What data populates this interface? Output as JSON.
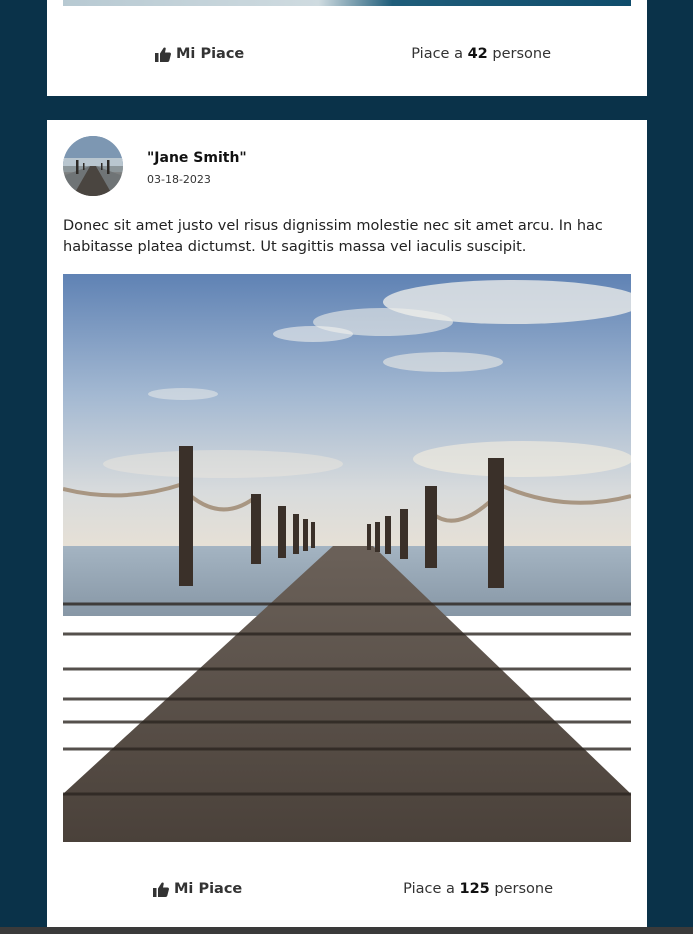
{
  "posts": [
    {
      "like_label": "Mi Piace",
      "likes_prefix": "Piace a ",
      "likes_count": "42",
      "likes_suffix": " persone",
      "like_icon": "thumbs-up-icon"
    },
    {
      "author": "\"Jane Smith\"",
      "date": "03-18-2023",
      "text": "Donec sit amet justo vel risus dignissim molestie nec sit amet arcu. In hac habitasse platea dictumst. Ut sagittis massa vel iaculis suscipit.",
      "like_label": "Mi Piace",
      "likes_prefix": "Piace a ",
      "likes_count": "125",
      "likes_suffix": " persone",
      "like_icon": "thumbs-up-icon"
    }
  ],
  "colors": {
    "page_background": "#0a3249",
    "card_background": "#ffffff"
  }
}
